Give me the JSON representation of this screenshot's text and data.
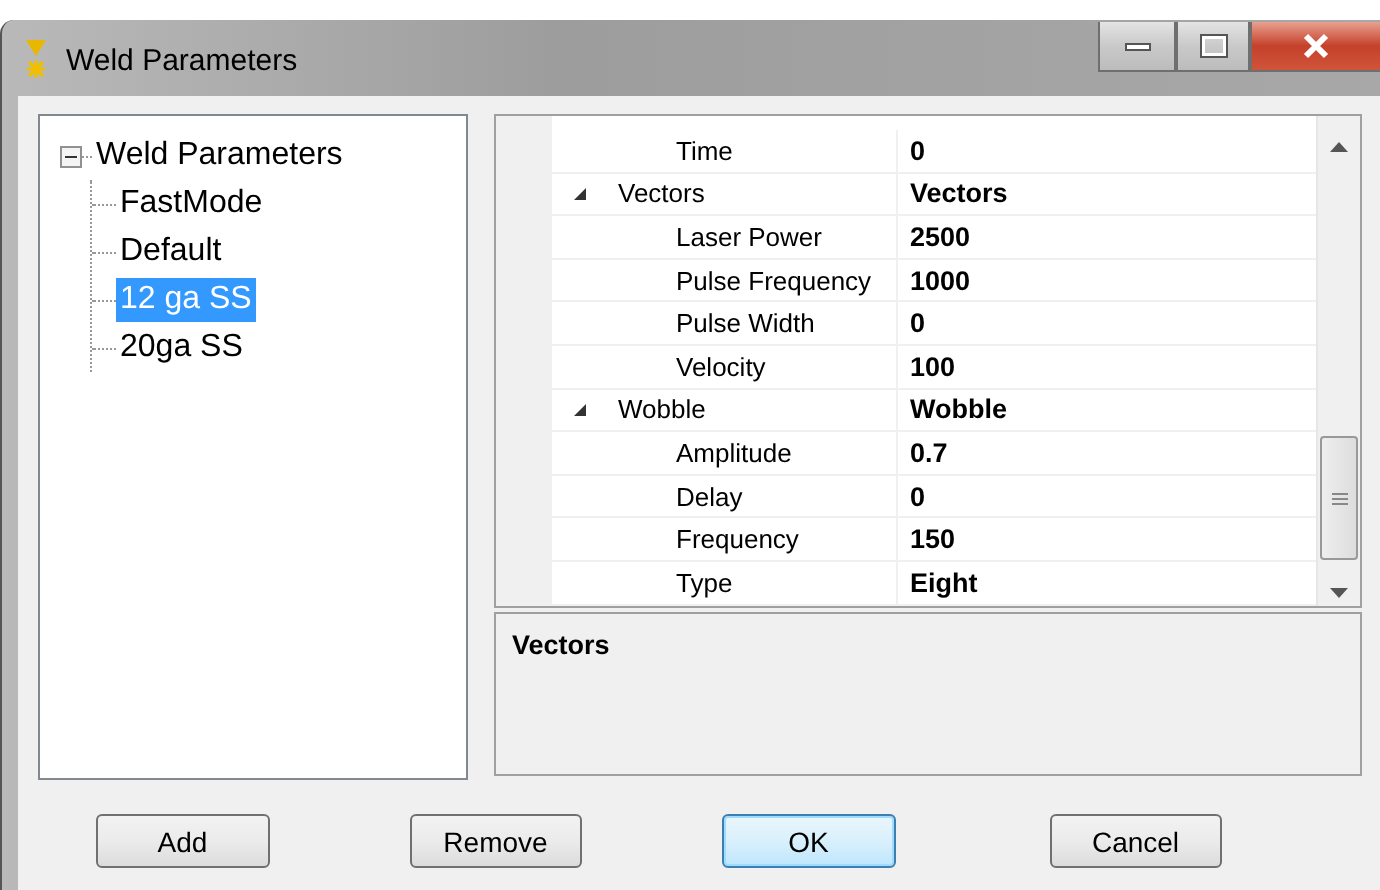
{
  "window": {
    "title": "Weld Parameters"
  },
  "tree": {
    "label": "Weld Parameters",
    "expanded": true,
    "children": [
      {
        "label": "FastMode",
        "selected": false
      },
      {
        "label": "Default",
        "selected": false
      },
      {
        "label": "12 ga SS",
        "selected": true
      },
      {
        "label": "20ga SS",
        "selected": false
      }
    ]
  },
  "properties": [
    {
      "kind": "property",
      "name": "Time",
      "value": "0"
    },
    {
      "kind": "category",
      "name": "Vectors",
      "value": "Vectors",
      "expanded": true
    },
    {
      "kind": "property",
      "name": "Laser Power",
      "value": "2500"
    },
    {
      "kind": "property",
      "name": "Pulse Frequency",
      "value": "1000"
    },
    {
      "kind": "property",
      "name": "Pulse Width",
      "value": "0"
    },
    {
      "kind": "property",
      "name": "Velocity",
      "value": "100"
    },
    {
      "kind": "category",
      "name": "Wobble",
      "value": "Wobble",
      "expanded": true
    },
    {
      "kind": "property",
      "name": "Amplitude",
      "value": "0.7"
    },
    {
      "kind": "property",
      "name": "Delay",
      "value": "0"
    },
    {
      "kind": "property",
      "name": "Frequency",
      "value": "150"
    },
    {
      "kind": "property",
      "name": "Type",
      "value": "Eight"
    }
  ],
  "description": {
    "title": "Vectors"
  },
  "buttons": [
    {
      "label": "Add",
      "default": false
    },
    {
      "label": "Remove",
      "default": false
    },
    {
      "label": "OK",
      "default": true
    },
    {
      "label": "Cancel",
      "default": false
    }
  ]
}
